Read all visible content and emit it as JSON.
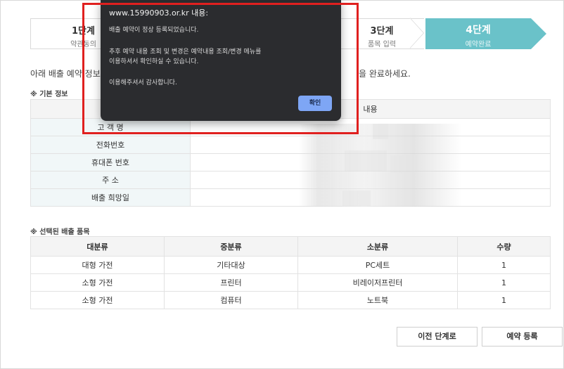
{
  "steps": [
    {
      "num": "1단계",
      "label": "약관동의"
    },
    {
      "num": "",
      "label": ""
    },
    {
      "num": "3단계",
      "label": "품목 입력"
    },
    {
      "num": "4단계",
      "label": "예약완료"
    }
  ],
  "intro": {
    "head": "아래 배출 예약 정보를",
    "tail": "을 완료하세요."
  },
  "section_basic": "※ 기본 정보",
  "section_items": "※ 선택된 배출 품목",
  "info_table": {
    "header_value": "내용",
    "rows": [
      "고 객 명",
      "전화번호",
      "휴대폰 번호",
      "주 소",
      "배출 희망일"
    ]
  },
  "items_table": {
    "headers": [
      "대분류",
      "중분류",
      "소분류",
      "수량"
    ],
    "rows": [
      [
        "대형 가전",
        "기타대상",
        "PC세트",
        "1"
      ],
      [
        "소형 가전",
        "프린터",
        "비레이저프린터",
        "1"
      ],
      [
        "소형 가전",
        "컴퓨터",
        "노트북",
        "1"
      ]
    ]
  },
  "buttons": {
    "prev": "이전 단계로",
    "submit": "예약 등록"
  },
  "dialog": {
    "title": "www.15990903.or.kr 내용:",
    "line1": "배출 예약이 정상 등록되었습니다.",
    "line2": "추후 예약 내용 조회 및 변경은 예약내용 조회/변경 메뉴를",
    "line3": "이용하셔서 확인하실 수 있습니다.",
    "line4": "이용해주셔서 감사합니다.",
    "ok": "확인"
  },
  "colors": {
    "accent": "#6ac2c9",
    "highlight": "#e0201f",
    "dialog_bg": "#2b2c2f",
    "ok_button": "#7ea6f5"
  }
}
